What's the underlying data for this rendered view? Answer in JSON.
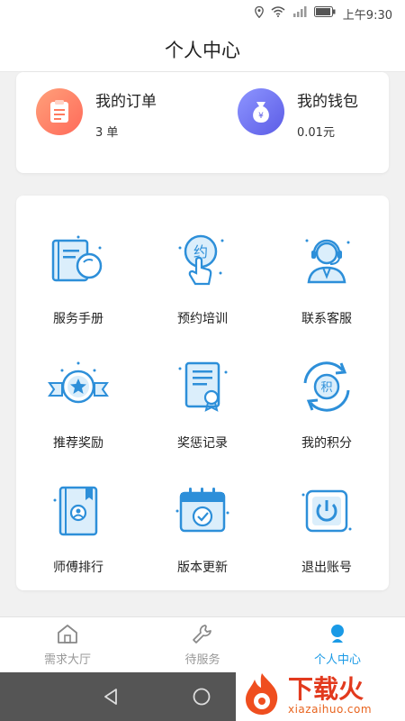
{
  "status": {
    "time": "上午9:30"
  },
  "header": {
    "title": "个人中心"
  },
  "summary": {
    "orders": {
      "title": "我的订单",
      "value": "3 单"
    },
    "wallet": {
      "title": "我的钱包",
      "value": "0.01元"
    }
  },
  "grid": [
    {
      "label": "服务手册",
      "icon": "manual-book-icon"
    },
    {
      "label": "预约培训",
      "icon": "appointment-icon"
    },
    {
      "label": "联系客服",
      "icon": "customer-service-icon"
    },
    {
      "label": "推荐奖励",
      "icon": "badge-star-icon"
    },
    {
      "label": "奖惩记录",
      "icon": "certificate-icon"
    },
    {
      "label": "我的积分",
      "icon": "points-icon"
    },
    {
      "label": "师傅排行",
      "icon": "ranking-icon"
    },
    {
      "label": "版本更新",
      "icon": "calendar-update-icon"
    },
    {
      "label": "退出账号",
      "icon": "power-icon"
    }
  ],
  "tabs": [
    {
      "label": "需求大厅"
    },
    {
      "label": "待服务"
    },
    {
      "label": "个人中心"
    }
  ],
  "watermark": {
    "title": "下载火",
    "subtitle": "xiazaihuo.com"
  },
  "colors": {
    "accent": "#1a9ae6",
    "icon_blue": "#2d8fd9",
    "orange": "#ff6a5a",
    "purple": "#5c5ce6"
  }
}
